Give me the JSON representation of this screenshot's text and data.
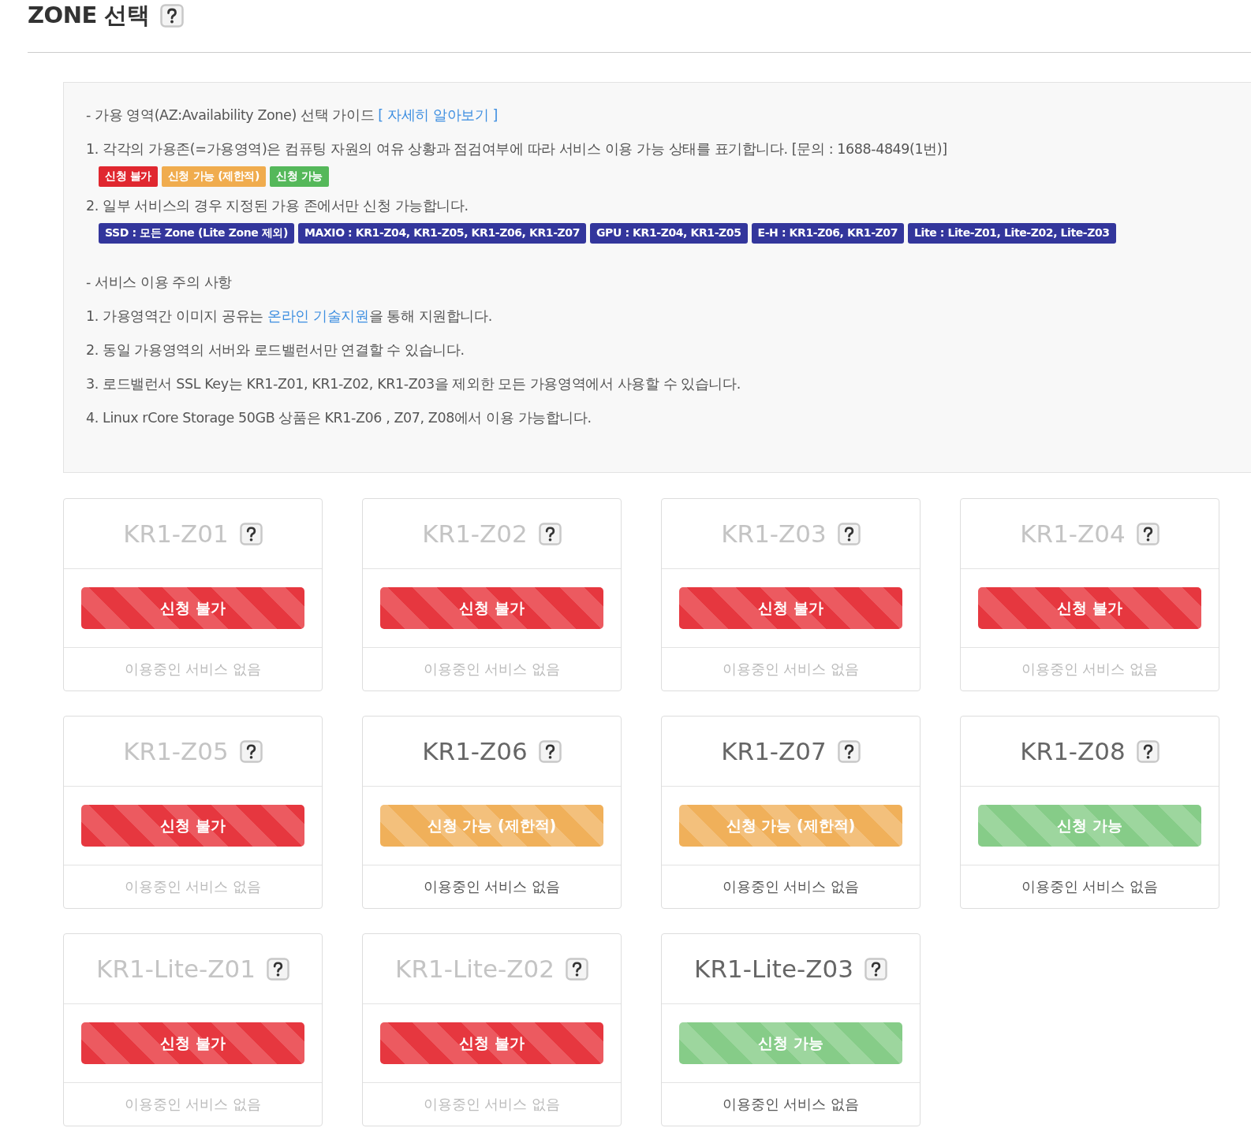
{
  "header": {
    "title": "ZONE 선택"
  },
  "guide": {
    "heading": "- 가용 영역(AZ:Availability Zone) 선택 가이드",
    "heading_link": "[ 자세히 알아보기 ]",
    "line_1": "1. 각각의 가용존(=가용영역)은 컴퓨팅 자원의 여유 상황과 점검여부에 따라 서비스 이용 가능 상태를 표기합니다. [문의 : 1688-4849(1번)]",
    "legend": [
      {
        "label": "신청 불가",
        "kind": "unavailable"
      },
      {
        "label": "신청 가능 (제한적)",
        "kind": "limited"
      },
      {
        "label": "신청 가능",
        "kind": "available"
      }
    ],
    "line_2": "2. 일부 서비스의 경우 지정된 가용 존에서만 신청 가능합니다.",
    "service_tags": [
      "SSD : 모든 Zone (Lite Zone 제외)",
      "MAXIO : KR1-Z04, KR1-Z05, KR1-Z06, KR1-Z07",
      "GPU : KR1-Z04, KR1-Z05",
      "E-H : KR1-Z06, KR1-Z07",
      "Lite : Lite-Z01, Lite-Z02, Lite-Z03"
    ]
  },
  "notice": {
    "heading": "- 서비스 이용 주의 사항",
    "line_1_before": "1. 가용영역간 이미지 공유는 ",
    "line_1_link": "온라인 기술지원",
    "line_1_after": "을 통해 지원합니다.",
    "lines": [
      "2. 동일 가용영역의 서버와 로드밸런서만 연결할 수 있습니다.",
      "3. 로드밸런서 SSL Key는 KR1-Z01, KR1-Z02, KR1-Z03을 제외한 모든 가용영역에서 사용할 수 있습니다.",
      "4. Linux rCore Storage 50GB 상품은 KR1-Z06 , Z07, Z08에서 이용 가능합니다."
    ]
  },
  "zones": [
    {
      "name": "KR1-Z01",
      "status": "신청 불가",
      "kind": "unavailable",
      "disabled": true,
      "usage": "이용중인 서비스 없음"
    },
    {
      "name": "KR1-Z02",
      "status": "신청 불가",
      "kind": "unavailable",
      "disabled": true,
      "usage": "이용중인 서비스 없음"
    },
    {
      "name": "KR1-Z03",
      "status": "신청 불가",
      "kind": "unavailable",
      "disabled": true,
      "usage": "이용중인 서비스 없음"
    },
    {
      "name": "KR1-Z04",
      "status": "신청 불가",
      "kind": "unavailable",
      "disabled": true,
      "usage": "이용중인 서비스 없음"
    },
    {
      "name": "KR1-Z05",
      "status": "신청 불가",
      "kind": "unavailable",
      "disabled": true,
      "usage": "이용중인 서비스 없음"
    },
    {
      "name": "KR1-Z06",
      "status": "신청 가능 (제한적)",
      "kind": "limited",
      "disabled": false,
      "usage": "이용중인 서비스 없음"
    },
    {
      "name": "KR1-Z07",
      "status": "신청 가능 (제한적)",
      "kind": "limited",
      "disabled": false,
      "usage": "이용중인 서비스 없음"
    },
    {
      "name": "KR1-Z08",
      "status": "신청 가능",
      "kind": "available",
      "disabled": false,
      "usage": "이용중인 서비스 없음"
    },
    {
      "name": "KR1-Lite-Z01",
      "status": "신청 불가",
      "kind": "unavailable",
      "disabled": true,
      "usage": "이용중인 서비스 없음"
    },
    {
      "name": "KR1-Lite-Z02",
      "status": "신청 불가",
      "kind": "unavailable",
      "disabled": true,
      "usage": "이용중인 서비스 없음"
    },
    {
      "name": "KR1-Lite-Z03",
      "status": "신청 가능",
      "kind": "available",
      "disabled": false,
      "usage": "이용중인 서비스 없음"
    }
  ]
}
